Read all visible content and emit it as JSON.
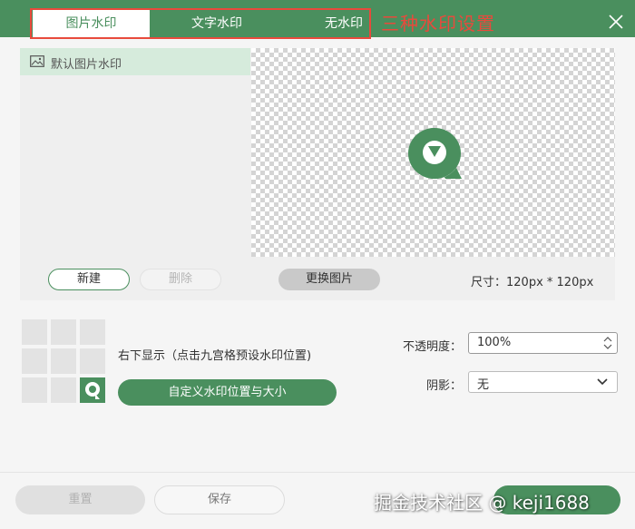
{
  "tabs": [
    {
      "label": "图片水印",
      "active": true
    },
    {
      "label": "文字水印",
      "active": false
    },
    {
      "label": "无水印",
      "active": false
    }
  ],
  "annotation": "三种水印设置",
  "list": {
    "items": [
      {
        "label": "默认图片水印",
        "icon": "image-icon"
      }
    ]
  },
  "buttons": {
    "new": "新建",
    "delete": "删除",
    "replace": "更换图片",
    "custom": "自定义水印位置与大小",
    "reset": "重置",
    "save": "保存"
  },
  "size_text": "尺寸：120px * 120px",
  "position": {
    "text": "右下显示（点击九宫格预设水印位置)",
    "selected_cell": 9
  },
  "opacity": {
    "label": "不透明度：",
    "value": "100%"
  },
  "shadow": {
    "label": "阴影：",
    "value": "无"
  },
  "watermark_overlay": "掘金技术社区 @ keji1688",
  "colors": {
    "brand": "#4a8f5e",
    "annotation": "#e84a3c"
  }
}
